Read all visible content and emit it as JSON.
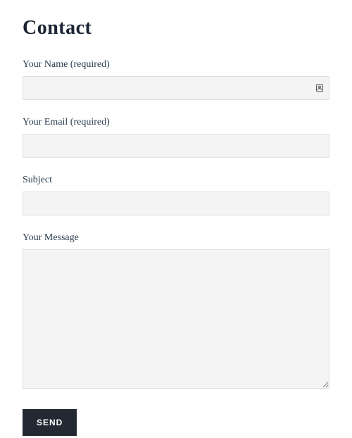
{
  "page": {
    "title": "Contact"
  },
  "form": {
    "name": {
      "label": "Your Name (required)",
      "value": ""
    },
    "email": {
      "label": "Your Email (required)",
      "value": ""
    },
    "subject": {
      "label": "Subject",
      "value": ""
    },
    "message": {
      "label": "Your Message",
      "value": ""
    },
    "submit": {
      "label": "SEND"
    }
  }
}
